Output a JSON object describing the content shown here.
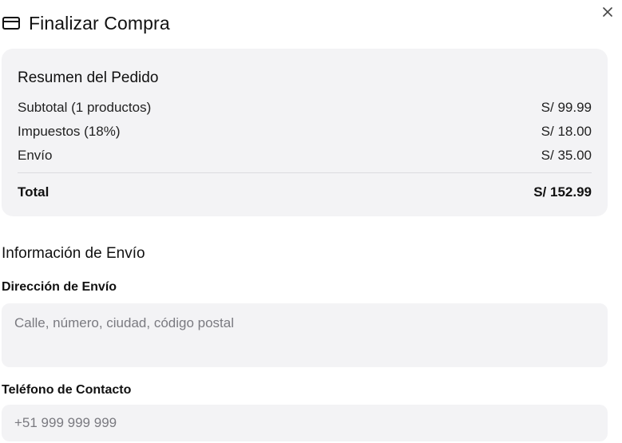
{
  "dialog": {
    "title": "Finalizar Compra",
    "title_icon": "credit-card-icon",
    "close_icon": "close-icon"
  },
  "summary": {
    "title": "Resumen del Pedido",
    "rows": [
      {
        "label": "Subtotal (1 productos)",
        "value": "S/ 99.99"
      },
      {
        "label": "Impuestos (18%)",
        "value": "S/ 18.00"
      },
      {
        "label": "Envío",
        "value": "S/ 35.00"
      }
    ],
    "total": {
      "label": "Total",
      "value": "S/ 152.99"
    }
  },
  "shipping": {
    "title": "Información de Envío",
    "address": {
      "label": "Dirección de Envío",
      "value": "",
      "placeholder": "Calle, número, ciudad, código postal"
    },
    "phone": {
      "label": "Teléfono de Contacto",
      "value": "",
      "placeholder": "+51 999 999 999"
    }
  },
  "colors": {
    "panel_bg": "#f3f3f5",
    "text": "#111111",
    "placeholder": "#7a7a80",
    "divider": "#dcdcdf"
  }
}
